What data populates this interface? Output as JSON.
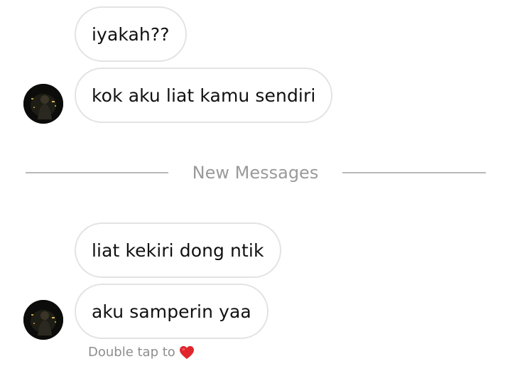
{
  "messages": [
    {
      "text": "iyakah??"
    },
    {
      "text": "kok aku liat kamu sendiri"
    },
    {
      "text": "liat kekiri dong ntik"
    },
    {
      "text": "aku samperin yaa"
    }
  ],
  "divider": {
    "label": "New Messages"
  },
  "hint": {
    "text": "Double tap to",
    "icon": "heart-icon",
    "icon_color": "#e0262c"
  },
  "colors": {
    "bubble_border": "#e3e3e3",
    "divider_line": "#b9b9b9",
    "divider_text": "#9a9a9a",
    "hint_text": "#8e8e8e"
  }
}
